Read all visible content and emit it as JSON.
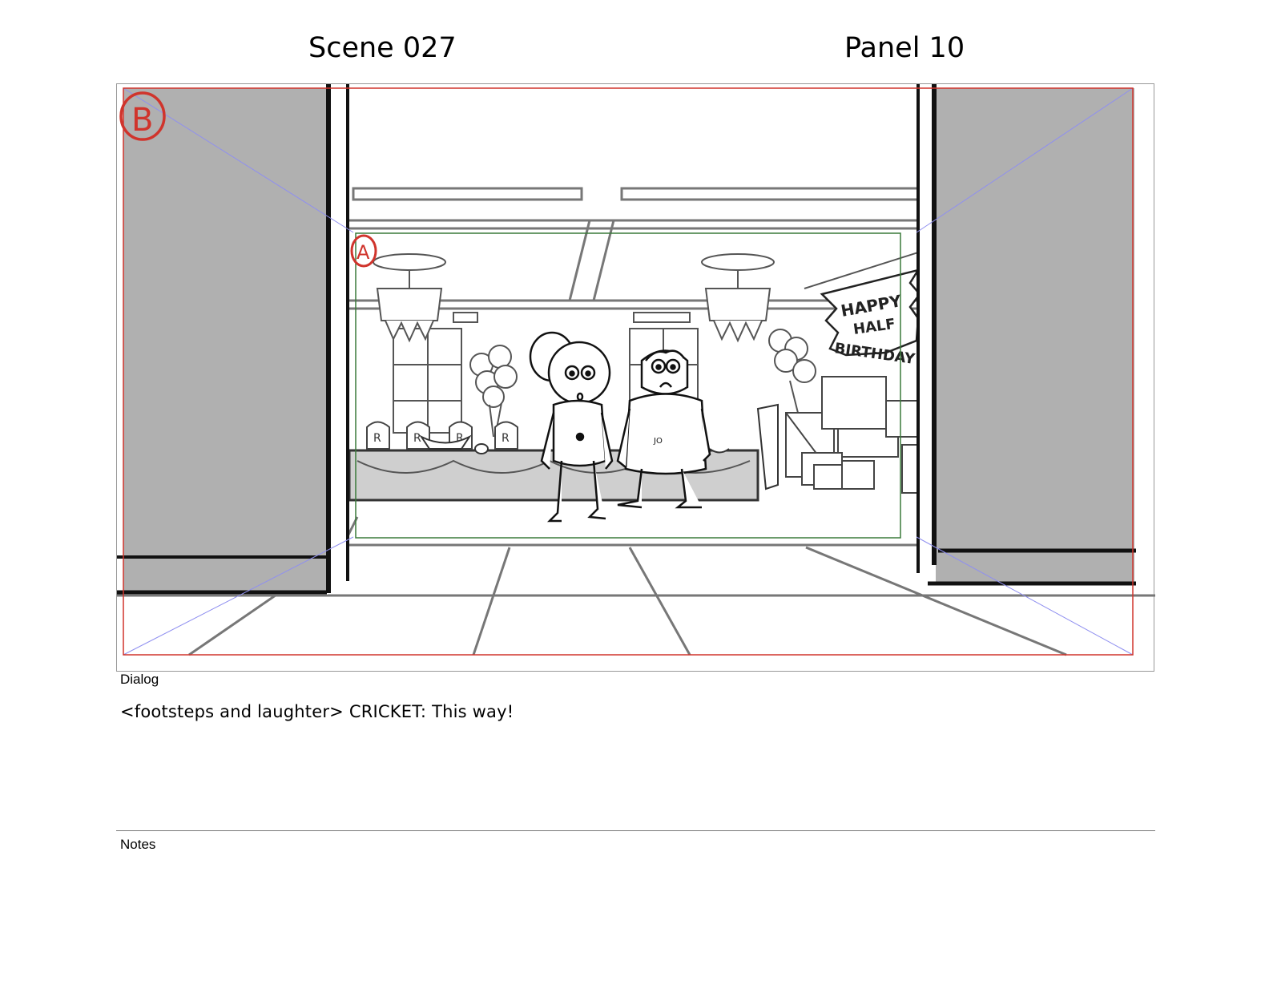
{
  "header": {
    "scene": "Scene 027",
    "panel": "Panel 10"
  },
  "frame": {
    "field_b_label": "B",
    "field_a_label": "A",
    "banner_lines": [
      "HAPPY",
      "HALF",
      "BIRTHDAY"
    ],
    "chair_letters": [
      "R",
      "R",
      "R",
      "R"
    ],
    "colors": {
      "field_b": "#d0342c",
      "field_a": "#3a7a3a",
      "guide": "#8f8ff0",
      "door": "#b0b0b0"
    }
  },
  "dialog": {
    "label": "Dialog",
    "text": "<footsteps and laughter> CRICKET:  This way!"
  },
  "notes": {
    "label": "Notes",
    "text": ""
  }
}
